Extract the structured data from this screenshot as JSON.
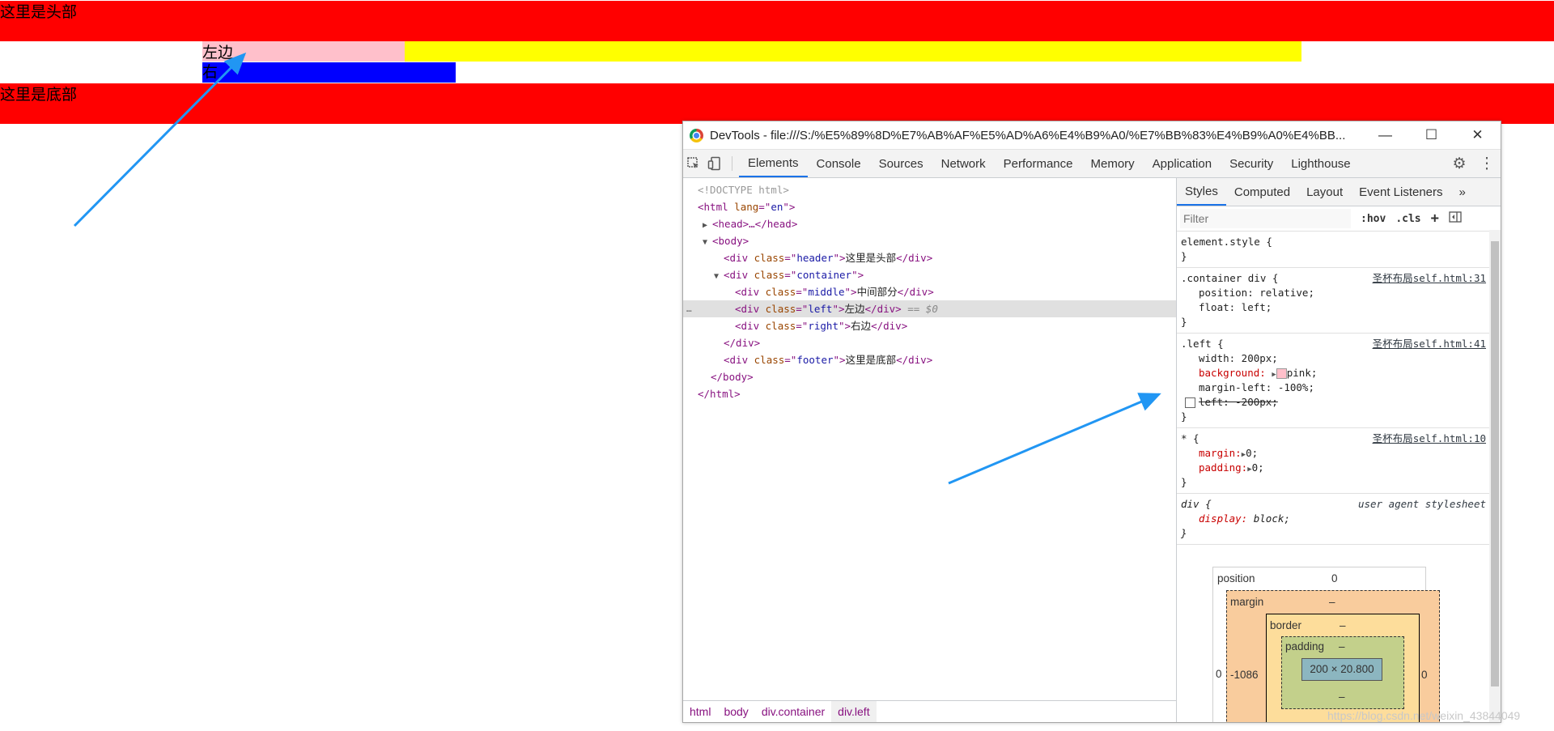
{
  "page": {
    "header_text": "这里是头部",
    "left_text": "左边",
    "right_text": "右",
    "footer_text": "这里是底部"
  },
  "devtools": {
    "title": "DevTools - file:///S:/%E5%89%8D%E7%AB%AF%E5%AD%A6%E4%B9%A0/%E7%BB%83%E4%B9%A0%E4%BB...",
    "window_buttons": {
      "minimize": "—",
      "maximize": "☐",
      "close": "✕"
    },
    "tabs": [
      "Elements",
      "Console",
      "Sources",
      "Network",
      "Performance",
      "Memory",
      "Application",
      "Security",
      "Lighthouse"
    ],
    "active_tab": "Elements",
    "elements": {
      "doctype": "<!DOCTYPE html>",
      "html_open": {
        "tag": "html",
        "attr": "lang",
        "val": "en"
      },
      "head": "<head>…</head>",
      "body_open": "<body>",
      "nodes": [
        {
          "cls": "header",
          "text": "这里是头部"
        },
        {
          "cls": "container"
        },
        {
          "cls": "middle",
          "text": "中间部分"
        },
        {
          "cls": "left",
          "text": "左边",
          "suffix": "== $0"
        },
        {
          "cls": "right",
          "text": "右边"
        },
        {
          "cls": "footer",
          "text": "这里是底部"
        }
      ],
      "div_close": "</div>",
      "body_close": "</body>",
      "html_close": "</html>",
      "dots": "…"
    },
    "breadcrumbs": [
      "html",
      "body",
      "div.container",
      "div.left"
    ],
    "styles": {
      "tabs": [
        "Styles",
        "Computed",
        "Layout",
        "Event Listeners"
      ],
      "more": "»",
      "filter_placeholder": "Filter",
      "hov": ":hov",
      "cls": ".cls",
      "plus": "+",
      "rules": {
        "element_style": {
          "selector": "element.style {",
          "close": "}"
        },
        "container": {
          "selector": ".container div {",
          "src_cn": "圣杯布局",
          "src": "self.html:31",
          "props": [
            "position: relative;",
            "float: left;"
          ]
        },
        "left": {
          "selector": ".left {",
          "src_cn": "圣杯布局",
          "src": "self.html:41",
          "width": "width: 200px;",
          "bg_name": "background:",
          "bg_val": "pink;",
          "margin": "margin-left: -100%;",
          "left_disabled": "left: -200px;"
        },
        "star": {
          "selector": "* {",
          "src_cn": "圣杯布局",
          "src": "self.html:10",
          "margin_name": "margin:",
          "margin_val": "0;",
          "padding_name": "padding:",
          "padding_val": "0;"
        },
        "div": {
          "selector": "div {",
          "src": "user agent stylesheet",
          "prop_name": "display:",
          "prop_val": "block;"
        }
      },
      "box_model": {
        "position_label": "position",
        "position_val": "0",
        "margin_label": "margin",
        "margin_top": "–",
        "margin_left": "-1086",
        "margin_right": "0",
        "outer_left": "0",
        "border_label": "border",
        "border_top": "–",
        "padding_label": "padding",
        "padding_top": "–",
        "padding_bottom": "–",
        "content": "200 × 20.800",
        "dash": "–"
      }
    }
  },
  "watermark": "https://blog.csdn.net/weixin_43844049",
  "colors": {
    "header": "#ff0000",
    "left": "#ffc0cb",
    "middle": "#ffff00",
    "right": "#0000ff",
    "arrow": "#2196f3",
    "active_tab": "#1a73e8"
  }
}
